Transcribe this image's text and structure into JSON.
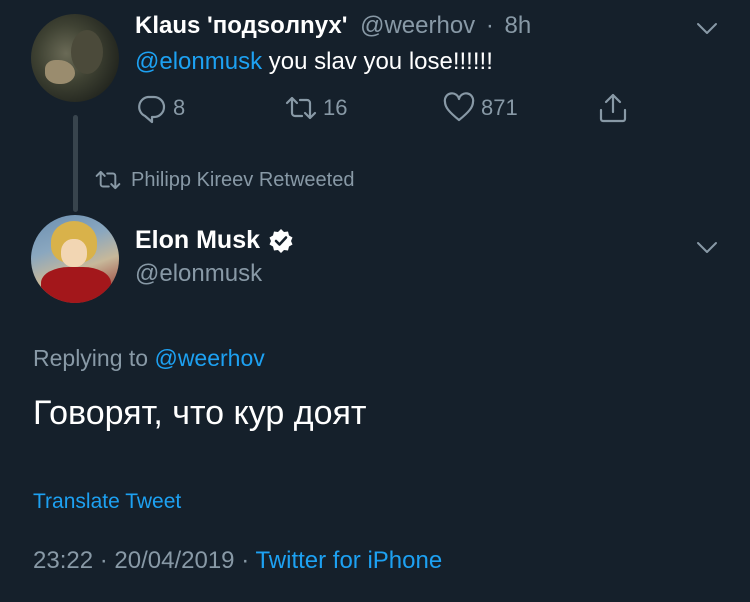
{
  "colors": {
    "background": "#15202b",
    "text_primary": "#ffffff",
    "text_secondary": "#8899a6",
    "accent": "#1da1f2",
    "thread_line": "#38444d"
  },
  "parent_tweet": {
    "author_name": "Klaus 'подsoлnух'",
    "author_handle": "@weerhov",
    "separator": "·",
    "time": "8h",
    "mention": "@elonmusk",
    "text": " you slav you lose!!!!!!",
    "actions": {
      "reply_icon": "reply-icon",
      "reply_count": "8",
      "retweet_icon": "retweet-icon",
      "retweet_count": "16",
      "like_icon": "heart-icon",
      "like_count": "871",
      "share_icon": "share-icon"
    }
  },
  "retweet_context": {
    "icon": "retweet-icon",
    "text": "Philipp Kireev Retweeted"
  },
  "main_tweet": {
    "author_name": "Elon Musk",
    "verified_icon": "verified-badge-icon",
    "author_handle": "@elonmusk",
    "replying_prefix": "Replying to ",
    "replying_handle": "@weerhov",
    "text": "Говорят, что кур доят",
    "translate_label": "Translate Tweet",
    "time": "23:22",
    "date": "20/04/2019",
    "separator": "·",
    "source": "Twitter for iPhone"
  }
}
